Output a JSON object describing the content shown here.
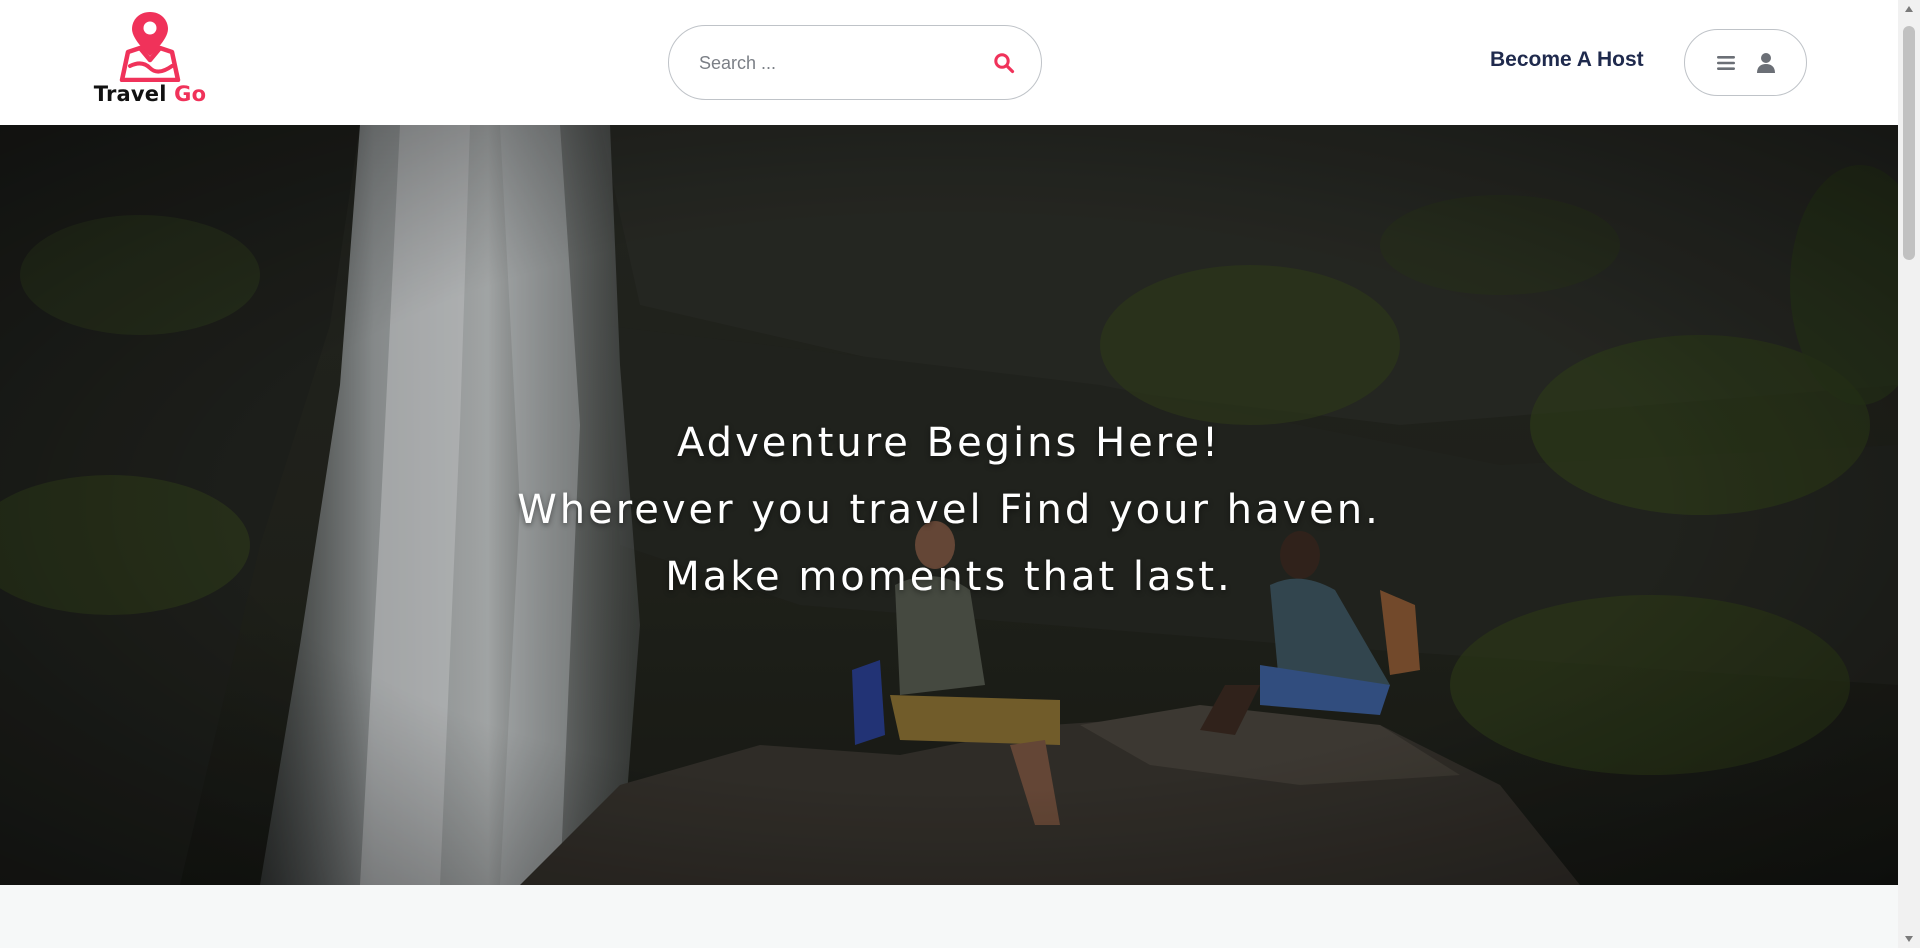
{
  "brand": {
    "name_part1": "Travel",
    "name_part2": "Go",
    "accent_color": "#f0325a"
  },
  "search": {
    "placeholder": "Search ...",
    "icon": "search-icon"
  },
  "nav": {
    "become_host_label": "Become A Host",
    "user_menu_icons": [
      "hamburger-menu-icon",
      "user-icon"
    ]
  },
  "hero": {
    "lines": [
      "Adventure Begins Here!",
      "Wherever you travel Find your haven.",
      "Make moments that last."
    ],
    "background": "waterfall-with-two-travelers-image"
  }
}
